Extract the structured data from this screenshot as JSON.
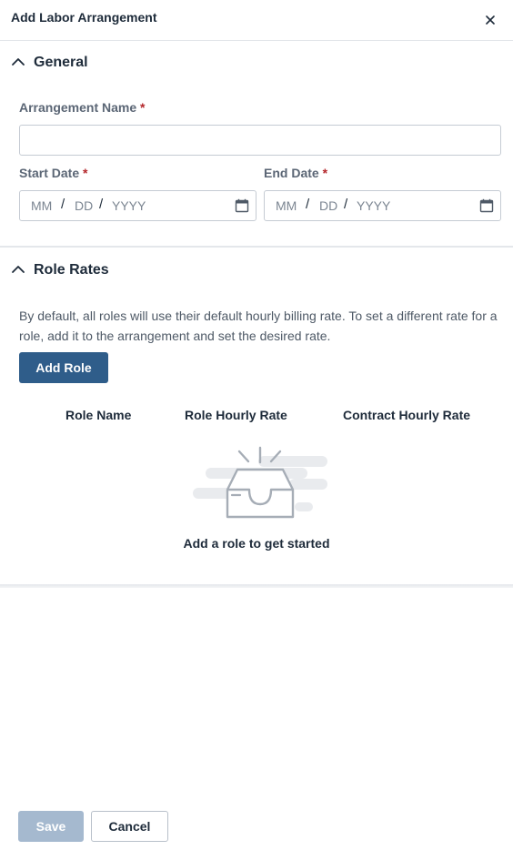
{
  "dialog": {
    "title": "Add Labor Arrangement",
    "close_icon": "close-icon"
  },
  "general": {
    "section_title": "General",
    "arrangement_name": {
      "label": "Arrangement Name",
      "required_mark": "*",
      "value": ""
    },
    "start_date": {
      "label": "Start Date",
      "required_mark": "*",
      "month_placeholder": "MM",
      "day_placeholder": "DD",
      "year_placeholder": "YYYY",
      "separator": "/",
      "icon": "calendar-icon"
    },
    "end_date": {
      "label": "End Date",
      "required_mark": "*",
      "month_placeholder": "MM",
      "day_placeholder": "DD",
      "year_placeholder": "YYYY",
      "separator": "/",
      "icon": "calendar-icon"
    }
  },
  "role_rates": {
    "section_title": "Role Rates",
    "description": "By default, all roles will use their default hourly billing rate. To set a different rate for a role, add it to the arrangement and set the desired rate.",
    "add_role_label": "Add Role",
    "columns": [
      "Role Name",
      "Role Hourly Rate",
      "Contract Hourly Rate"
    ],
    "empty_icon": "empty-inbox-icon",
    "empty_message": "Add a role to get started"
  },
  "footer": {
    "save_label": "Save",
    "cancel_label": "Cancel"
  },
  "colors": {
    "primary": "#2f5d8a",
    "primary_disabled": "#a5b9cf",
    "required": "#b4262b"
  }
}
